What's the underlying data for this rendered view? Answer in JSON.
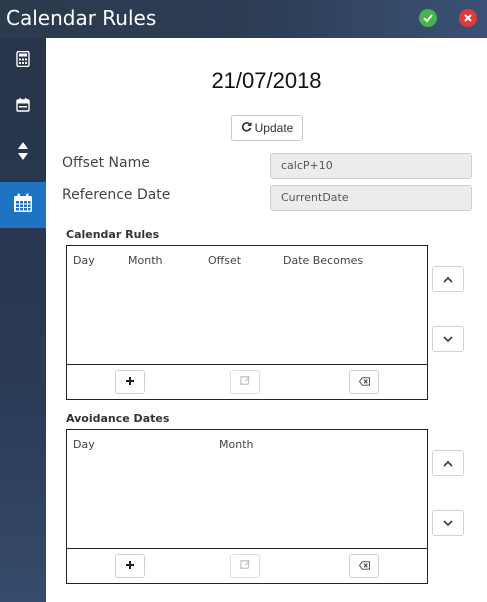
{
  "window": {
    "title": "Calendar Rules",
    "ok_icon": "check-circle-icon",
    "close_icon": "close-circle-icon",
    "ok_color": "#47b34a",
    "close_color": "#e03a3a"
  },
  "sidebar": {
    "items": [
      {
        "icon": "calculator-icon",
        "active": false
      },
      {
        "icon": "calendar-small-icon",
        "active": false
      },
      {
        "icon": "up-down-arrows-icon",
        "active": false
      },
      {
        "icon": "calendar-grid-icon",
        "active": true
      }
    ],
    "active_color": "#1f73c2"
  },
  "main": {
    "date": "21/07/2018",
    "update_button": {
      "label": "Update",
      "icon": "refresh-icon"
    },
    "offset_name": {
      "label": "Offset Name",
      "value": "calcP+10"
    },
    "reference_date": {
      "label": "Reference Date",
      "value": "CurrentDate"
    }
  },
  "calendar_rules": {
    "title": "Calendar Rules",
    "columns": [
      "Day",
      "Month",
      "Offset",
      "Date Becomes"
    ],
    "rows": [],
    "toolbar": {
      "add_icon": "plus-icon",
      "edit_icon": "edit-icon",
      "delete_icon": "backspace-icon"
    }
  },
  "avoidance_dates": {
    "title": "Avoidance Dates",
    "columns": [
      "Day",
      "Month"
    ],
    "rows": [],
    "toolbar": {
      "add_icon": "plus-icon",
      "edit_icon": "edit-icon",
      "delete_icon": "backspace-icon"
    }
  },
  "nav": {
    "up_icon": "chevron-up-icon",
    "down_icon": "chevron-down-icon"
  }
}
